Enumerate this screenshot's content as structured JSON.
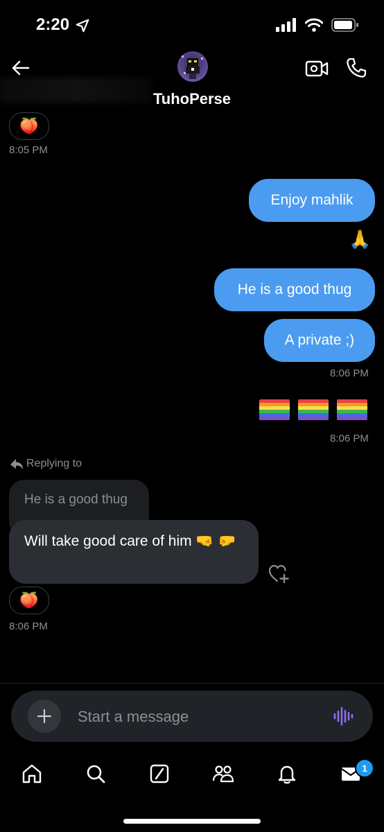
{
  "status_bar": {
    "time": "2:20"
  },
  "header": {
    "title": "TuhoPerse"
  },
  "messages": {
    "top_reaction": "🍑",
    "top_timestamp": "8:05 PM",
    "outgoing_1": "Enjoy mahlik",
    "outgoing_emoji": "🙏",
    "outgoing_2": "He is a good thug",
    "outgoing_3": "A private ;)",
    "outgoing_timestamp_1": "8:06 PM",
    "flags": [
      "🏳️‍🌈",
      "🏳️‍🌈",
      "🏳️‍🌈"
    ],
    "outgoing_timestamp_2": "8:06 PM",
    "replying_label": "Replying to",
    "quoted_text": "He is a good thug",
    "incoming_text": "Will take good care of him 🤜 🤛",
    "incoming_reaction": "🍑",
    "incoming_timestamp": "8:06 PM"
  },
  "composer": {
    "placeholder": "Start a message"
  },
  "tabbar": {
    "messages_badge": "1"
  },
  "colors": {
    "outgoing_bubble": "#4b9cf0",
    "incoming_bubble": "#2b2e32",
    "voice_icon": "#8c6df2",
    "badge": "#1d9bf0"
  }
}
